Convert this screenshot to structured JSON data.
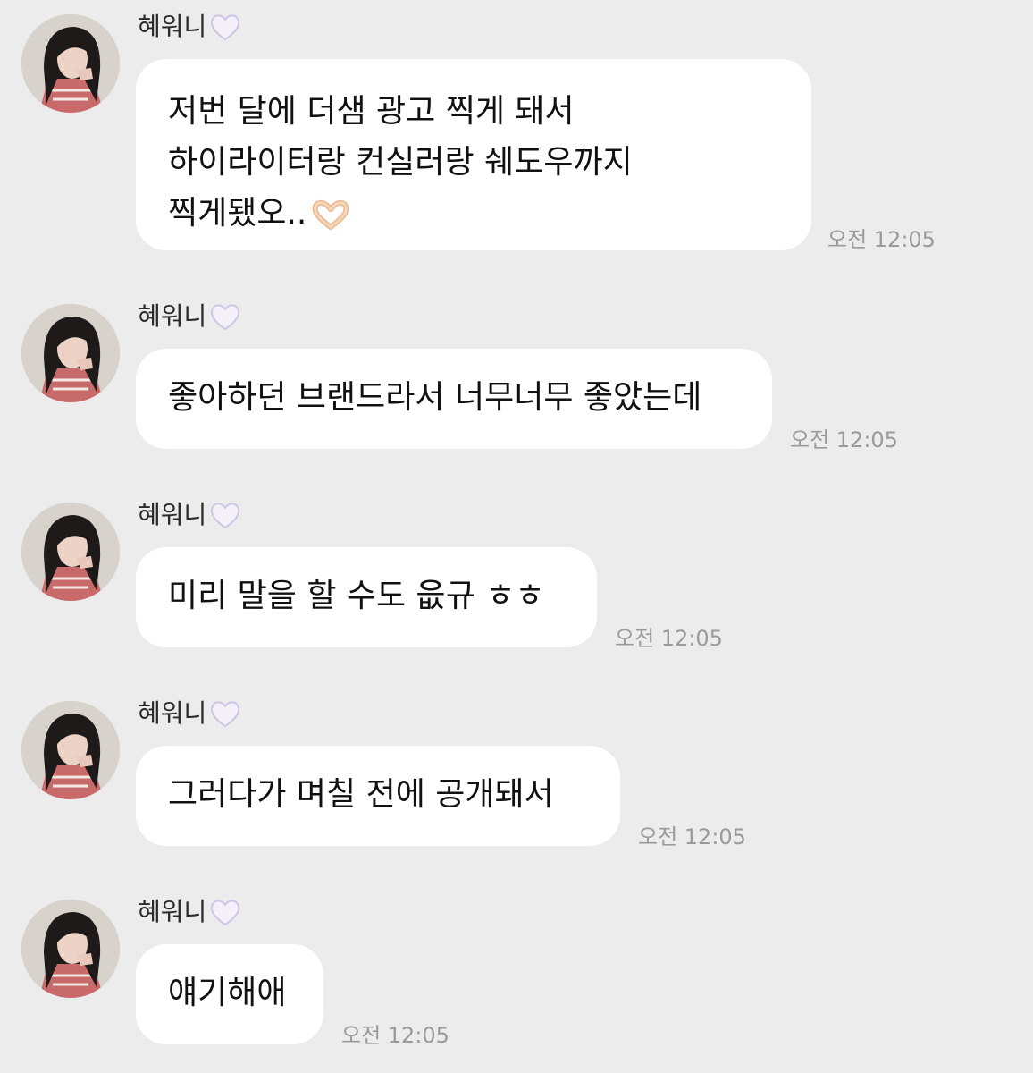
{
  "sender": {
    "name": "혜워니"
  },
  "messages": [
    {
      "lines": [
        "저번 달에 더샘 광고 찍게 돼서",
        "하이라이터랑 컨실러랑 쉐도우까지",
        "찍게됐오.."
      ],
      "has_heart_hands_emoji": true,
      "time": "오전 12:05"
    },
    {
      "lines": [
        "좋아하던 브랜드라서 너무너무 좋았는데"
      ],
      "time": "오전 12:05"
    },
    {
      "lines": [
        "미리 말을 할 수도 읎규 ㅎㅎ"
      ],
      "time": "오전 12:05"
    },
    {
      "lines": [
        "그러다가 며칠 전에 공개돼서"
      ],
      "time": "오전 12:05"
    },
    {
      "lines": [
        "얘기해애"
      ],
      "time": "오전 12:05"
    }
  ],
  "icons": {
    "name_suffix": "white-heart-icon",
    "emoji": "heart-hands-icon"
  },
  "colors": {
    "background": "#ececec",
    "bubble": "#ffffff",
    "timestamp": "#9a9a9a"
  }
}
